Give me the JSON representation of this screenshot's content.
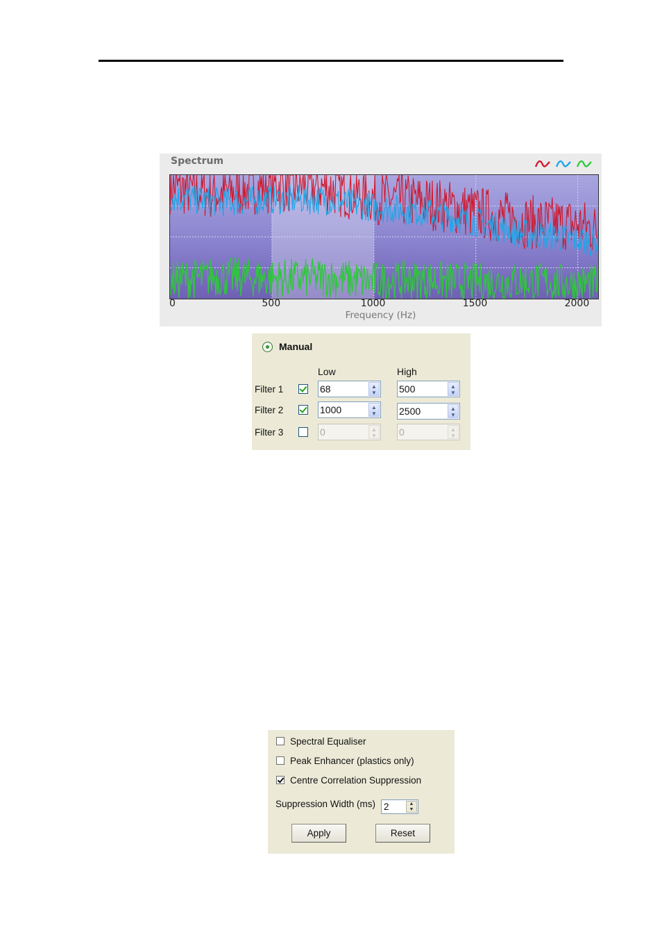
{
  "spectrum": {
    "title": "Spectrum",
    "xlabel": "Frequency (Hz)",
    "legend_icons": [
      "red-wave-icon",
      "blue-wave-icon",
      "green-wave-icon"
    ],
    "colors": {
      "red": "#d0182c",
      "blue": "#1aa6e8",
      "green": "#2ec83a"
    }
  },
  "chart_data": {
    "type": "line",
    "xlabel": "Frequency (Hz)",
    "ylabel": "",
    "xlim": [
      0,
      2100
    ],
    "x_ticks": [
      "0",
      "500",
      "1000",
      "1500",
      "2000"
    ],
    "highlight_band": [
      500,
      1000
    ],
    "grid": true,
    "series": [
      {
        "color": "#d0182c",
        "x": [
          0,
          250,
          500,
          750,
          1000,
          1250,
          1500,
          1750,
          2000,
          2100
        ],
        "values": [
          0.9,
          0.85,
          0.92,
          0.9,
          0.82,
          0.78,
          0.7,
          0.62,
          0.6,
          0.55
        ]
      },
      {
        "color": "#1aa6e8",
        "x": [
          0,
          250,
          500,
          750,
          1000,
          1250,
          1500,
          1750,
          2000,
          2100
        ],
        "values": [
          0.82,
          0.78,
          0.8,
          0.8,
          0.74,
          0.7,
          0.62,
          0.52,
          0.48,
          0.45
        ]
      },
      {
        "color": "#2ec83a",
        "x": [
          0,
          250,
          500,
          750,
          1000,
          1250,
          1500,
          1750,
          2000,
          2100
        ],
        "values": [
          0.15,
          0.18,
          0.16,
          0.17,
          0.14,
          0.15,
          0.13,
          0.14,
          0.12,
          0.12
        ]
      }
    ]
  },
  "filter_panel": {
    "mode_label": "Manual",
    "low_header": "Low",
    "high_header": "High",
    "rows": [
      {
        "label": "Filter 1",
        "checked": true,
        "low": "68",
        "high": "500",
        "enabled": true
      },
      {
        "label": "Filter 2",
        "checked": true,
        "low": "1000",
        "high": "2500",
        "enabled": true
      },
      {
        "label": "Filter 3",
        "checked": false,
        "low": "0",
        "high": "0",
        "enabled": false
      }
    ]
  },
  "options_panel": {
    "options": [
      {
        "label": "Spectral Equaliser",
        "checked": false
      },
      {
        "label": "Peak Enhancer (plastics only)",
        "checked": false
      },
      {
        "label": "Centre Correlation Suppression",
        "checked": true
      }
    ],
    "suppression_width_label": "Suppression Width (ms)",
    "suppression_width_value": "2",
    "apply_label": "Apply",
    "reset_label": "Reset"
  }
}
